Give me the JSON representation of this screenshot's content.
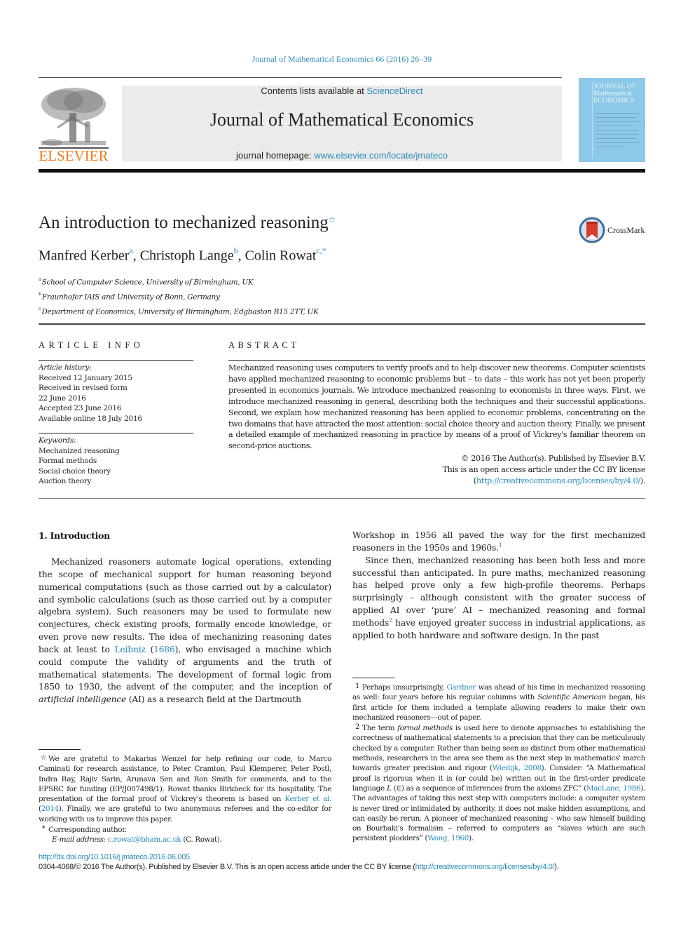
{
  "header": {
    "citation": "Journal of Mathematical Economics 66 (2016) 26–39",
    "publisher_logo_text": "ELSEVIER",
    "contents_prefix": "Contents lists available at ",
    "contents_link": "ScienceDirect",
    "journal_title": "Journal of Mathematical Economics",
    "homepage_prefix": "journal homepage: ",
    "homepage_link": "www.elsevier.com/locate/jmateco",
    "cover_title_lines": [
      "JOURNAL OF",
      "Mathematical",
      "ECONOMICS"
    ]
  },
  "article": {
    "title": "An introduction to mechanized reasoning",
    "title_mark": "☆",
    "crossmark_label": "CrossMark",
    "authors": [
      {
        "name": "Manfred Kerber",
        "sup": "a",
        "sep": ", "
      },
      {
        "name": "Christoph Lange",
        "sup": "b",
        "sep": ", "
      },
      {
        "name": "Colin Rowat",
        "sup": "c,*",
        "sep": ""
      }
    ],
    "affiliations": [
      {
        "sup": "a",
        "text": "School of Computer Science, University of Birmingham, UK"
      },
      {
        "sup": "b",
        "text": "Fraunhofer IAIS and University of Bonn, Germany"
      },
      {
        "sup": "c",
        "text": "Department of Economics, University of Birmingham, Edgbaston B15 2TT, UK"
      }
    ]
  },
  "article_info": {
    "heading": "ARTICLE INFO",
    "history_label": "Article history:",
    "history": [
      "Received 12 January 2015",
      "Received in revised form",
      "22 June 2016",
      "Accepted 23 June 2016",
      "Available online 18 July 2016"
    ],
    "keywords_label": "Keywords:",
    "keywords": [
      "Mechanized reasoning",
      "Formal methods",
      "Social choice theory",
      "Auction theory"
    ]
  },
  "abstract": {
    "heading": "ABSTRACT",
    "text": "Mechanized reasoning uses computers to verify proofs and to help discover new theorems. Computer scientists have applied mechanized reasoning to economic problems but – to date – this work has not yet been properly presented in economics journals. We introduce mechanized reasoning to economists in three ways. First, we introduce mechanized reasoning in general, describing both the techniques and their successful applications. Second, we explain how mechanized reasoning has been applied to economic problems, concentrating on the two domains that have attracted the most attention: social choice theory and auction theory. Finally, we present a detailed example of mechanized reasoning in practice by means of a proof of Vickrey's familiar theorem on second-price auctions.",
    "copyright": "© 2016 The Author(s). Published by Elsevier B.V.",
    "license": "This is an open access article under the CC BY license",
    "license_url_open": "(",
    "license_url": "http://creativecommons.org/licenses/by/4.0/",
    "license_url_close": ")."
  },
  "body": {
    "section_title": "1.  Introduction",
    "left_para": {
      "part1": "Mechanized reasoners automate logical operations, extending the scope of mechanical support for human reasoning beyond numerical computations (such as those carried out by a calculator) and symbolic calculations (such as those carried out by a computer algebra system). Such reasoners may be used to formulate new conjectures, check existing proofs, formally encode knowledge, or even prove new results. The idea of mechanizing reasoning dates back at least to ",
      "cite_name": "Leibniz",
      "cite_open": " (",
      "cite_year": "1686",
      "part2": "), who envisaged a machine which could compute the validity of arguments and the truth of mathematical statements. The development of formal logic from 1850 to 1930, the advent of the computer, and the inception of ",
      "italic": "artificial intelligence",
      "part3": " (AI) as a research field at the Dartmouth"
    },
    "right_para1": {
      "text": "Workshop in 1956 all paved the way for the first mechanized reasoners in the 1950s and 1960s.",
      "fn": "1"
    },
    "right_para2": {
      "part1": "Since then, mechanized reasoning has been both less and more successful than anticipated. In pure maths, mechanized reasoning has helped prove only a few high-profile theorems. Perhaps surprisingly – although consistent with the greater success of applied AI over ‘pure’ AI – mechanized reasoning and formal methods",
      "fn": "2",
      "part2": " have enjoyed greater success in industrial applications, as applied to both hardware and software design. In the past"
    }
  },
  "footnotes": {
    "star": {
      "mark": "☆",
      "part1": "We are grateful to Makarius Wenzel for help refining our code, to Marco Caminati for research assistance, to Peter Cramton, Paul Klemperer, Peter Postl, Indra Ray, Rajiv Sarin, Arunava Sen and Ron Smith for comments, and to the EPSRC for funding (EP/J007498/1). Rowat thanks Birkbeck for its hospitality. The presentation of the formal proof of Vickrey's theorem is based on ",
      "cite": "Kerber et al.",
      "cite_year_open": " (",
      "cite_year": "2014",
      "part2": "). Finally, we are grateful to two anonymous referees and the co-editor for working with us to improve this paper."
    },
    "corresponding": {
      "mark": "*",
      "text": "Corresponding author.",
      "email_label": "E-mail address:",
      "email": "c.rowat@bham.ac.uk",
      "email_suffix": " (C. Rowat)."
    },
    "fn1": {
      "mark": "1",
      "part1": "Perhaps unsurprisingly, ",
      "cite": "Gardner",
      "part2": " was ahead of his time in mechanized reasoning as well: four years before his regular columns with ",
      "italic": "Scientific American",
      "part3": " began, his first article for them included a template allowing readers to make their own mechanized reasoners—out of paper."
    },
    "fn2": {
      "mark": "2",
      "part1": "The term ",
      "italic": "formal methods",
      "part2": " is used here to denote approaches to establishing the correctness of mathematical statements to a precision that they can be meticulously checked by a computer. Rather than being seen as distinct from other mathematical methods, researchers in the area see them as the next step in mathematics' march towards greater precision and rigour (",
      "cite1": "Wiedijk, 2008",
      "part3": "). Consider: “A Mathematical proof is rigorous when it is (or could be) written out in the first-order predicate language ",
      "italic2": "L",
      "part4": " (∈) as a sequence of inferences from the axioms ZFC” (",
      "cite2": "MacLane, 1986",
      "part5": "). The advantages of taking this next step with computers include: a computer system is never tired or intimidated by authority, it does not make hidden assumptions, and can easily be rerun. A pioneer of mechanized reasoning – who saw himself building on Bourbaki's formalism – referred to computers as “slaves which are such persistent plodders” (",
      "cite3": "Wang, 1960",
      "part6": ")."
    }
  },
  "footer": {
    "doi": "http://dx.doi.org/10.1016/j.jmateco.2016.06.005",
    "issn_text": "0304-4068/© 2016 The Author(s). Published by Elsevier B.V. This is an open access article under the CC BY license (",
    "license_url": "http://creativecommons.org/licenses/by/4.0/",
    "issn_close": ")."
  },
  "colors": {
    "link": "#2a8ab8",
    "elsevier_orange": "#f07a1a",
    "cover_blue": "#8cc8e8",
    "banner_gray": "#ebebeb"
  }
}
